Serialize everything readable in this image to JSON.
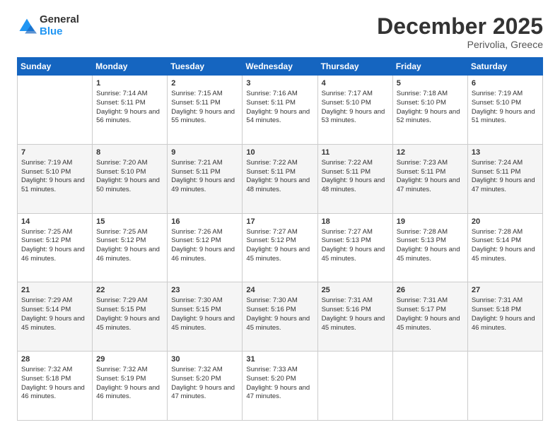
{
  "header": {
    "logo_general": "General",
    "logo_blue": "Blue",
    "month": "December 2025",
    "location": "Perivolia, Greece"
  },
  "weekdays": [
    "Sunday",
    "Monday",
    "Tuesday",
    "Wednesday",
    "Thursday",
    "Friday",
    "Saturday"
  ],
  "weeks": [
    [
      {
        "day": "",
        "sunrise": "",
        "sunset": "",
        "daylight": ""
      },
      {
        "day": "1",
        "sunrise": "Sunrise: 7:14 AM",
        "sunset": "Sunset: 5:11 PM",
        "daylight": "Daylight: 9 hours and 56 minutes."
      },
      {
        "day": "2",
        "sunrise": "Sunrise: 7:15 AM",
        "sunset": "Sunset: 5:11 PM",
        "daylight": "Daylight: 9 hours and 55 minutes."
      },
      {
        "day": "3",
        "sunrise": "Sunrise: 7:16 AM",
        "sunset": "Sunset: 5:11 PM",
        "daylight": "Daylight: 9 hours and 54 minutes."
      },
      {
        "day": "4",
        "sunrise": "Sunrise: 7:17 AM",
        "sunset": "Sunset: 5:10 PM",
        "daylight": "Daylight: 9 hours and 53 minutes."
      },
      {
        "day": "5",
        "sunrise": "Sunrise: 7:18 AM",
        "sunset": "Sunset: 5:10 PM",
        "daylight": "Daylight: 9 hours and 52 minutes."
      },
      {
        "day": "6",
        "sunrise": "Sunrise: 7:19 AM",
        "sunset": "Sunset: 5:10 PM",
        "daylight": "Daylight: 9 hours and 51 minutes."
      }
    ],
    [
      {
        "day": "7",
        "sunrise": "Sunrise: 7:19 AM",
        "sunset": "Sunset: 5:10 PM",
        "daylight": "Daylight: 9 hours and 51 minutes."
      },
      {
        "day": "8",
        "sunrise": "Sunrise: 7:20 AM",
        "sunset": "Sunset: 5:10 PM",
        "daylight": "Daylight: 9 hours and 50 minutes."
      },
      {
        "day": "9",
        "sunrise": "Sunrise: 7:21 AM",
        "sunset": "Sunset: 5:11 PM",
        "daylight": "Daylight: 9 hours and 49 minutes."
      },
      {
        "day": "10",
        "sunrise": "Sunrise: 7:22 AM",
        "sunset": "Sunset: 5:11 PM",
        "daylight": "Daylight: 9 hours and 48 minutes."
      },
      {
        "day": "11",
        "sunrise": "Sunrise: 7:22 AM",
        "sunset": "Sunset: 5:11 PM",
        "daylight": "Daylight: 9 hours and 48 minutes."
      },
      {
        "day": "12",
        "sunrise": "Sunrise: 7:23 AM",
        "sunset": "Sunset: 5:11 PM",
        "daylight": "Daylight: 9 hours and 47 minutes."
      },
      {
        "day": "13",
        "sunrise": "Sunrise: 7:24 AM",
        "sunset": "Sunset: 5:11 PM",
        "daylight": "Daylight: 9 hours and 47 minutes."
      }
    ],
    [
      {
        "day": "14",
        "sunrise": "Sunrise: 7:25 AM",
        "sunset": "Sunset: 5:12 PM",
        "daylight": "Daylight: 9 hours and 46 minutes."
      },
      {
        "day": "15",
        "sunrise": "Sunrise: 7:25 AM",
        "sunset": "Sunset: 5:12 PM",
        "daylight": "Daylight: 9 hours and 46 minutes."
      },
      {
        "day": "16",
        "sunrise": "Sunrise: 7:26 AM",
        "sunset": "Sunset: 5:12 PM",
        "daylight": "Daylight: 9 hours and 46 minutes."
      },
      {
        "day": "17",
        "sunrise": "Sunrise: 7:27 AM",
        "sunset": "Sunset: 5:12 PM",
        "daylight": "Daylight: 9 hours and 45 minutes."
      },
      {
        "day": "18",
        "sunrise": "Sunrise: 7:27 AM",
        "sunset": "Sunset: 5:13 PM",
        "daylight": "Daylight: 9 hours and 45 minutes."
      },
      {
        "day": "19",
        "sunrise": "Sunrise: 7:28 AM",
        "sunset": "Sunset: 5:13 PM",
        "daylight": "Daylight: 9 hours and 45 minutes."
      },
      {
        "day": "20",
        "sunrise": "Sunrise: 7:28 AM",
        "sunset": "Sunset: 5:14 PM",
        "daylight": "Daylight: 9 hours and 45 minutes."
      }
    ],
    [
      {
        "day": "21",
        "sunrise": "Sunrise: 7:29 AM",
        "sunset": "Sunset: 5:14 PM",
        "daylight": "Daylight: 9 hours and 45 minutes."
      },
      {
        "day": "22",
        "sunrise": "Sunrise: 7:29 AM",
        "sunset": "Sunset: 5:15 PM",
        "daylight": "Daylight: 9 hours and 45 minutes."
      },
      {
        "day": "23",
        "sunrise": "Sunrise: 7:30 AM",
        "sunset": "Sunset: 5:15 PM",
        "daylight": "Daylight: 9 hours and 45 minutes."
      },
      {
        "day": "24",
        "sunrise": "Sunrise: 7:30 AM",
        "sunset": "Sunset: 5:16 PM",
        "daylight": "Daylight: 9 hours and 45 minutes."
      },
      {
        "day": "25",
        "sunrise": "Sunrise: 7:31 AM",
        "sunset": "Sunset: 5:16 PM",
        "daylight": "Daylight: 9 hours and 45 minutes."
      },
      {
        "day": "26",
        "sunrise": "Sunrise: 7:31 AM",
        "sunset": "Sunset: 5:17 PM",
        "daylight": "Daylight: 9 hours and 45 minutes."
      },
      {
        "day": "27",
        "sunrise": "Sunrise: 7:31 AM",
        "sunset": "Sunset: 5:18 PM",
        "daylight": "Daylight: 9 hours and 46 minutes."
      }
    ],
    [
      {
        "day": "28",
        "sunrise": "Sunrise: 7:32 AM",
        "sunset": "Sunset: 5:18 PM",
        "daylight": "Daylight: 9 hours and 46 minutes."
      },
      {
        "day": "29",
        "sunrise": "Sunrise: 7:32 AM",
        "sunset": "Sunset: 5:19 PM",
        "daylight": "Daylight: 9 hours and 46 minutes."
      },
      {
        "day": "30",
        "sunrise": "Sunrise: 7:32 AM",
        "sunset": "Sunset: 5:20 PM",
        "daylight": "Daylight: 9 hours and 47 minutes."
      },
      {
        "day": "31",
        "sunrise": "Sunrise: 7:33 AM",
        "sunset": "Sunset: 5:20 PM",
        "daylight": "Daylight: 9 hours and 47 minutes."
      },
      {
        "day": "",
        "sunrise": "",
        "sunset": "",
        "daylight": ""
      },
      {
        "day": "",
        "sunrise": "",
        "sunset": "",
        "daylight": ""
      },
      {
        "day": "",
        "sunrise": "",
        "sunset": "",
        "daylight": ""
      }
    ]
  ]
}
